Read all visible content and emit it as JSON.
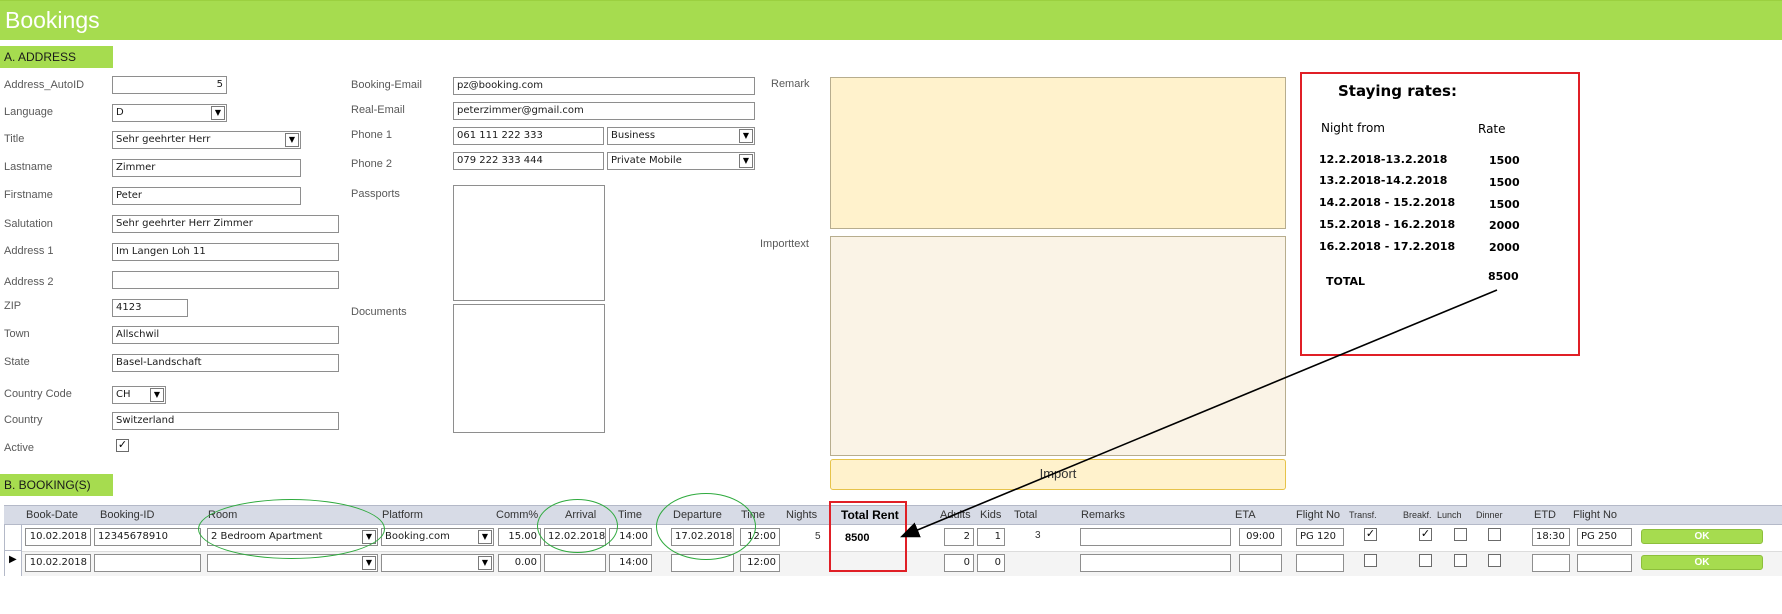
{
  "app": {
    "title": "Bookings"
  },
  "address": {
    "section_label": "A. ADDRESS",
    "fields": {
      "address_autoid": {
        "label": "Address_AutoID",
        "value": "5"
      },
      "language": {
        "label": "Language",
        "value": "D"
      },
      "title": {
        "label": "Title",
        "value": "Sehr geehrter Herr"
      },
      "lastname": {
        "label": "Lastname",
        "value": "Zimmer"
      },
      "firstname": {
        "label": "Firstname",
        "value": "Peter"
      },
      "salutation": {
        "label": "Salutation",
        "value": "Sehr geehrter Herr Zimmer"
      },
      "address1": {
        "label": "Address 1",
        "value": "Im Langen Loh 11"
      },
      "address2": {
        "label": "Address 2",
        "value": ""
      },
      "zip": {
        "label": "ZIP",
        "value": "4123"
      },
      "town": {
        "label": "Town",
        "value": "Allschwil"
      },
      "state": {
        "label": "State",
        "value": "Basel-Landschaft"
      },
      "country_code": {
        "label": "Country Code",
        "value": "CH"
      },
      "country": {
        "label": "Country",
        "value": "Switzerland"
      },
      "active": {
        "label": "Active",
        "checked": true
      },
      "booking_email": {
        "label": "Booking-Email",
        "value": "pz@booking.com"
      },
      "real_email": {
        "label": "Real-Email",
        "value": "peterzimmer@gmail.com"
      },
      "phone1": {
        "label": "Phone 1",
        "value": "061 111 222 333",
        "type": "Business"
      },
      "phone2": {
        "label": "Phone 2",
        "value": "079 222 333 444",
        "type": "Private Mobile"
      },
      "passports": {
        "label": "Passports"
      },
      "documents": {
        "label": "Documents"
      },
      "remark": {
        "label": "Remark"
      },
      "importtext": {
        "label": "Importtext"
      },
      "import_button": "Import"
    }
  },
  "rates": {
    "title": "Staying rates:",
    "col_night": "Night from",
    "col_rate": "Rate",
    "rows": [
      {
        "night": "12.2.2018-13.2.2018",
        "rate": "1500"
      },
      {
        "night": "13.2.2018-14.2.2018",
        "rate": "1500"
      },
      {
        "night": "14.2.2018 - 15.2.2018",
        "rate": "1500"
      },
      {
        "night": "15.2.2018 - 16.2.2018",
        "rate": "2000"
      },
      {
        "night": "16.2.2018 - 17.2.2018",
        "rate": "2000"
      }
    ],
    "total_label": "TOTAL",
    "total_value": "8500"
  },
  "bookings": {
    "section_label": "B. BOOKING(S)",
    "columns": {
      "book_date": "Book-Date",
      "booking_id": "Booking-ID",
      "room": "Room",
      "platform": "Platform",
      "comm": "Comm%",
      "arrival": "Arrival",
      "time1": "Time",
      "departure": "Departure",
      "time2": "Time",
      "nights": "Nights",
      "total_rent": "Total Rent",
      "adults": "Adults",
      "kids": "Kids",
      "total": "Total",
      "remarks": "Remarks",
      "eta": "ETA",
      "flight_no1": "Flight No",
      "transf": "Transf.",
      "breakf": "Breakf.",
      "lunch": "Lunch",
      "dinner": "Dinner",
      "etd": "ETD",
      "flight_no2": "Flight No"
    },
    "rows": [
      {
        "book_date": "10.02.2018",
        "booking_id": "12345678910",
        "room": "2 Bedroom Apartment",
        "platform": "Booking.com",
        "comm": "15.00",
        "arrival": "12.02.2018",
        "time1": "14:00",
        "departure": "17.02.2018",
        "time2": "12:00",
        "nights": "5",
        "total_rent": "8500",
        "adults": "2",
        "kids": "1",
        "total": "3",
        "remarks": "",
        "eta": "09:00",
        "flight_no1": "PG 120",
        "transf": true,
        "breakf": true,
        "lunch": false,
        "dinner": false,
        "etd": "18:30",
        "flight_no2": "PG 250",
        "ok": "OK"
      },
      {
        "book_date": "10.02.2018",
        "booking_id": "",
        "room": "",
        "platform": "",
        "comm": "0.00",
        "arrival": "",
        "time1": "14:00",
        "departure": "",
        "time2": "12:00",
        "nights": "",
        "total_rent": "",
        "adults": "0",
        "kids": "0",
        "total": "",
        "remarks": "",
        "eta": "",
        "flight_no1": "",
        "transf": false,
        "breakf": false,
        "lunch": false,
        "dinner": false,
        "etd": "",
        "flight_no2": "",
        "ok": "OK"
      }
    ]
  },
  "colors": {
    "accent": "#a6dc4f",
    "annotation_red": "#e01f26",
    "annotation_green": "#2faa3e",
    "remark_bg": "#fff2cc",
    "import_bg": "#faf3e6"
  }
}
